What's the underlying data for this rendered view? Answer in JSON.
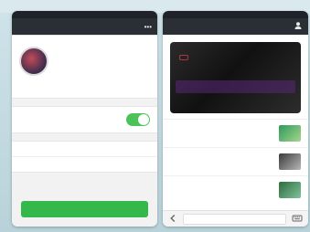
{
  "left_phone": {
    "nav": {
      "back": "",
      "title": "",
      "more": "•••"
    },
    "profile": {
      "name": "",
      "id": ""
    },
    "intro": {
      "label": "",
      "text": ""
    },
    "toggle_row": {
      "label": "",
      "state": "on"
    },
    "menu_items": [
      "",
      ""
    ],
    "primary_button": ""
  },
  "right_phone": {
    "nav": {
      "back": "",
      "title": "",
      "person_icon": "person-icon"
    },
    "hero": {
      "stamp": "",
      "caption": ""
    },
    "news": [
      {
        "text": ""
      },
      {
        "text": ""
      },
      {
        "text": ""
      }
    ],
    "bottom_left_icon": "chevron-left-icon",
    "bottom_right_icon": "keyboard-icon"
  },
  "colors": {
    "nav_bg": "#2a2f36",
    "accent_green": "#34b84a",
    "toggle_green": "#4cc35a"
  }
}
